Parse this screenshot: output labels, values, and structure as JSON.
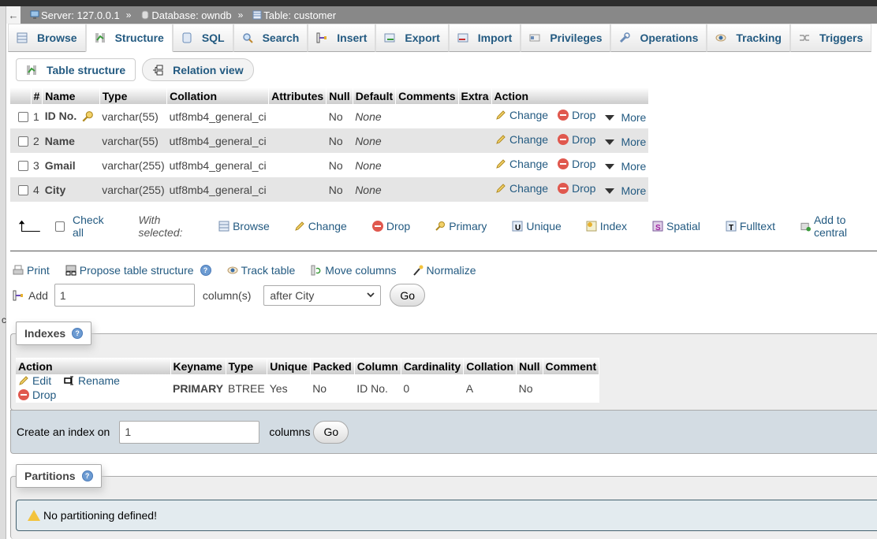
{
  "breadcrumb": {
    "back": "←",
    "server": "Server: 127.0.0.1",
    "database": "Database: owndb",
    "table": "Table: customer",
    "separator": "»"
  },
  "tabs": [
    {
      "label": "Browse",
      "icon": "browse-icon",
      "active": false
    },
    {
      "label": "Structure",
      "icon": "structure-icon",
      "active": true
    },
    {
      "label": "SQL",
      "icon": "sql-icon",
      "active": false
    },
    {
      "label": "Search",
      "icon": "search-icon",
      "active": false
    },
    {
      "label": "Insert",
      "icon": "insert-icon",
      "active": false
    },
    {
      "label": "Export",
      "icon": "export-icon",
      "active": false
    },
    {
      "label": "Import",
      "icon": "import-icon",
      "active": false
    },
    {
      "label": "Privileges",
      "icon": "privileges-icon",
      "active": false
    },
    {
      "label": "Operations",
      "icon": "wrench-icon",
      "active": false
    },
    {
      "label": "Tracking",
      "icon": "eye-icon",
      "active": false
    },
    {
      "label": "Triggers",
      "icon": "triggers-icon",
      "active": false
    }
  ],
  "subtabs": [
    {
      "label": "Table structure",
      "icon": "structure-icon"
    },
    {
      "label": "Relation view",
      "icon": "relation-icon"
    }
  ],
  "structure": {
    "headers": [
      "#",
      "Name",
      "Type",
      "Collation",
      "Attributes",
      "Null",
      "Default",
      "Comments",
      "Extra",
      "Action"
    ],
    "rows": [
      {
        "num": "1",
        "name": "ID No.",
        "primary_key": true,
        "type": "varchar(55)",
        "collation": "utf8mb4_general_ci",
        "attributes": "",
        "null": "No",
        "default": "None",
        "comments": "",
        "extra": ""
      },
      {
        "num": "2",
        "name": "Name",
        "primary_key": false,
        "type": "varchar(55)",
        "collation": "utf8mb4_general_ci",
        "attributes": "",
        "null": "No",
        "default": "None",
        "comments": "",
        "extra": ""
      },
      {
        "num": "3",
        "name": "Gmail",
        "primary_key": false,
        "type": "varchar(255)",
        "collation": "utf8mb4_general_ci",
        "attributes": "",
        "null": "No",
        "default": "None",
        "comments": "",
        "extra": ""
      },
      {
        "num": "4",
        "name": "City",
        "primary_key": false,
        "type": "varchar(255)",
        "collation": "utf8mb4_general_ci",
        "attributes": "",
        "null": "No",
        "default": "None",
        "comments": "",
        "extra": ""
      }
    ],
    "row_actions": {
      "change": "Change",
      "drop": "Drop",
      "more": "More"
    }
  },
  "with_selected": {
    "check_all": "Check all",
    "label": "With selected:",
    "actions": [
      "Browse",
      "Change",
      "Drop",
      "Primary",
      "Unique",
      "Index",
      "Spatial",
      "Fulltext",
      "Add to central"
    ]
  },
  "tools": {
    "print": "Print",
    "propose": "Propose table structure",
    "track": "Track table",
    "move": "Move columns",
    "normalize": "Normalize"
  },
  "add_columns": {
    "label": "Add",
    "count": "1",
    "unit": "column(s)",
    "position": "after City",
    "go": "Go"
  },
  "indexes": {
    "legend": "Indexes",
    "headers": [
      "Action",
      "Keyname",
      "Type",
      "Unique",
      "Packed",
      "Column",
      "Cardinality",
      "Collation",
      "Null",
      "Comment"
    ],
    "actions": {
      "edit": "Edit",
      "rename": "Rename",
      "drop": "Drop"
    },
    "rows": [
      {
        "keyname": "PRIMARY",
        "type": "BTREE",
        "unique": "Yes",
        "packed": "No",
        "column": "ID No.",
        "cardinality": "0",
        "collation": "A",
        "null": "No",
        "comment": ""
      }
    ],
    "create_label": "Create an index on",
    "create_count": "1",
    "create_unit": "columns",
    "go": "Go"
  },
  "partitions": {
    "legend": "Partitions",
    "notice": "No partitioning defined!"
  },
  "stray_char": "c"
}
